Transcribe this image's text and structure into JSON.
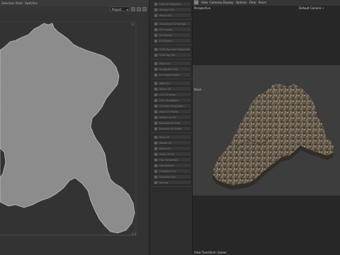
{
  "uv_editor": {
    "menus": [
      "Selection",
      "Paint",
      "Switches"
    ],
    "project_select": "Project",
    "axis_labels": [
      "U",
      "0.0",
      "0.0"
    ]
  },
  "tools": {
    "groups": [
      [
        "Optimal Mapping",
        "Realign UVs",
        "Relax UVs"
      ],
      [
        "Transform UV Islands",
        "Fit Canvas",
        "UV Terrain",
        "UV Stretch"
      ],
      [
        "UVW Tag from Projection",
        "UVW Tag Set"
      ],
      [
        "Align UV",
        "Straighten UVs",
        "UV Island Select"
      ],
      [
        "Weld UV",
        "Stitch UV",
        "Cut UV Seam",
        "Grid Straighten",
        "UV Ruler Straighten",
        "Align UV Points",
        "Stretch to Fill",
        "Equalize UV Grid",
        "Equalize UV Scale"
      ],
      [
        "Pack UV",
        "Rotate UV",
        "Mirror UV",
        "Scale UV Fit",
        "Flip Horizontal",
        "Flip Vertical",
        "Combine UVs",
        "Equalize Size",
        "Remap"
      ]
    ]
  },
  "viewport": {
    "menus": [
      "View",
      "Cameras",
      "Display",
      "Options",
      "Filter",
      "Panel"
    ],
    "perspective": "Perspective",
    "camera": "Default Camera",
    "camera_mark": "⊹",
    "marker": "Mesh",
    "status": "View Transform: Scene"
  },
  "colors": {
    "uv_fill": "#8c8c8c",
    "uv_stroke": "#d9d9d9",
    "terrain_base": "#5f5548"
  }
}
